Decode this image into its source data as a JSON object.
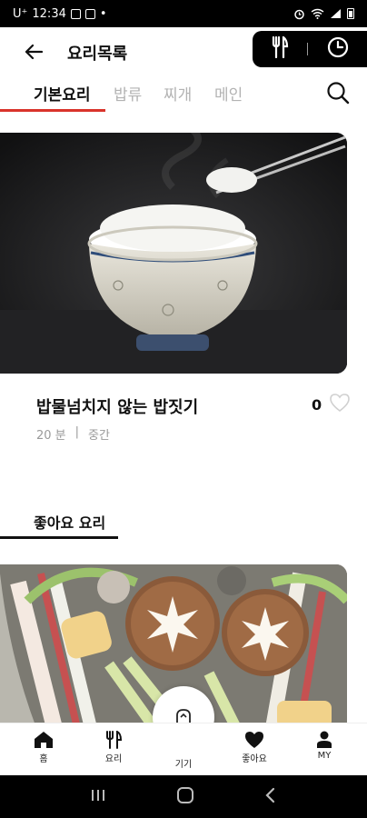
{
  "status_bar": {
    "carrier": "U⁺",
    "time": "12:34",
    "dot": "•"
  },
  "header": {
    "title": "요리목록",
    "back_icon": "arrow-left-icon",
    "utensils_icon": "fork-knife-icon",
    "clock_icon": "clock-icon"
  },
  "tabs": [
    {
      "label": "기본요리",
      "active": true
    },
    {
      "label": "밥류",
      "active": false
    },
    {
      "label": "찌개",
      "active": false
    },
    {
      "label": "메인",
      "active": false
    }
  ],
  "recipe": {
    "title": "밥물넘치지 않는 밥짓기",
    "time": "20 분",
    "separator": "|",
    "difficulty": "중간",
    "likes": "0"
  },
  "section": {
    "title": "좋아요 요리"
  },
  "bottom_nav": {
    "items": [
      {
        "label": "홈",
        "icon": "home-icon"
      },
      {
        "label": "요리",
        "icon": "fork-knife-icon"
      },
      {
        "label": "기기",
        "icon": "cooker-icon"
      },
      {
        "label": "좋아요",
        "icon": "heart-icon"
      },
      {
        "label": "MY",
        "icon": "person-icon"
      }
    ]
  },
  "colors": {
    "accent": "#d9332b",
    "header_actions_bg": "#000000",
    "inactive_tab": "#b3b3b3"
  }
}
